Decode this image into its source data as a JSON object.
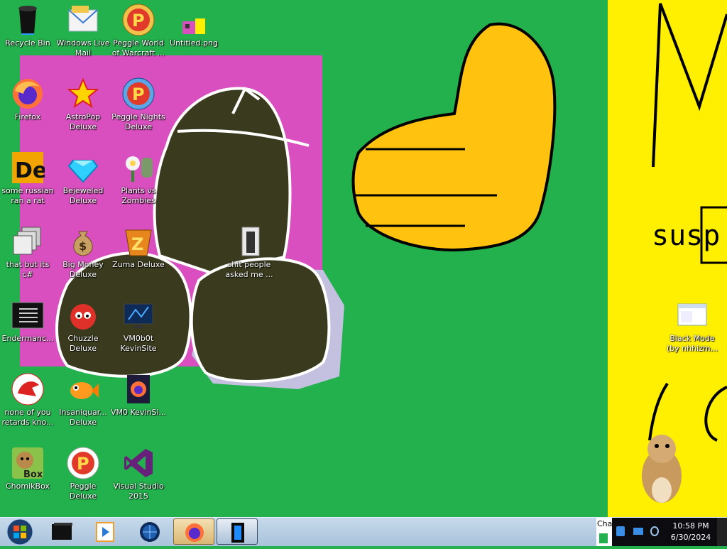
{
  "desktop": {
    "icons": [
      {
        "name": "recycle-bin-icon",
        "label": "Recycle Bin"
      },
      {
        "name": "windows-live-mail-icon",
        "label": "Windows Live Mail"
      },
      {
        "name": "peggle-world-of-warcraft-icon",
        "label": "Peggle World of Warcraft ..."
      },
      {
        "name": "untitled-png-icon",
        "label": "Untitled.png"
      },
      {
        "name": "firefox-icon",
        "label": "Firefox"
      },
      {
        "name": "astropop-deluxe-icon",
        "label": "AstroPop Deluxe"
      },
      {
        "name": "peggle-nights-deluxe-icon",
        "label": "Peggle Nights Deluxe"
      },
      {
        "name": "russian-rat-icon",
        "label": "some russian ran a rat"
      },
      {
        "name": "bejeweled-deluxe-icon",
        "label": "Bejeweled Deluxe"
      },
      {
        "name": "plants-vs-zombies-icon",
        "label": "Plants vs Zombies"
      },
      {
        "name": "that-but-its-csharp-icon",
        "label": "that but its c#"
      },
      {
        "name": "big-money-deluxe-icon",
        "label": "Big Money Deluxe"
      },
      {
        "name": "zuma-deluxe-icon",
        "label": "Zuma Deluxe"
      },
      {
        "name": "folder-icon",
        "label": "shit people asked me ..."
      },
      {
        "name": "enderman-icon",
        "label": "Endermanc..."
      },
      {
        "name": "chuzzle-deluxe-icon",
        "label": "Chuzzle Deluxe"
      },
      {
        "name": "vm0b0t-kevinsite-icon",
        "label": "VM0b0t KevinSite"
      },
      {
        "name": "black-mode-icon",
        "label": "Black Mode (by nhhizm..."
      },
      {
        "name": "none-of-you-icon",
        "label": "none of you retards kno..."
      },
      {
        "name": "insaniquarium-deluxe-icon",
        "label": "Insaniquar... Deluxe"
      },
      {
        "name": "vm0-kevinsite-icon",
        "label": "VM0 KevinSi..."
      },
      {
        "name": "chomikbox-icon",
        "label": "ChomikBox"
      },
      {
        "name": "peggle-deluxe-icon",
        "label": "Peggle Deluxe"
      },
      {
        "name": "visual-studio-2015-icon",
        "label": "Visual Studio 2015"
      }
    ],
    "wallpaper_text": {
      "susp": "susp",
      "box_text": "Box",
      "de_text": "De"
    }
  },
  "taskbar": {
    "tray_text": "Cha",
    "time": "10:58 PM",
    "date": "6/30/2024"
  },
  "colors": {
    "wallpaper_green": "#22b14c",
    "wallpaper_pink": "#d94fbf",
    "wallpaper_yellow": "#ffef00",
    "thumb_yellow": "#ffc20e",
    "drawing_dark": "#3a3a1e",
    "drawing_lavender": "#c4c0e0"
  }
}
